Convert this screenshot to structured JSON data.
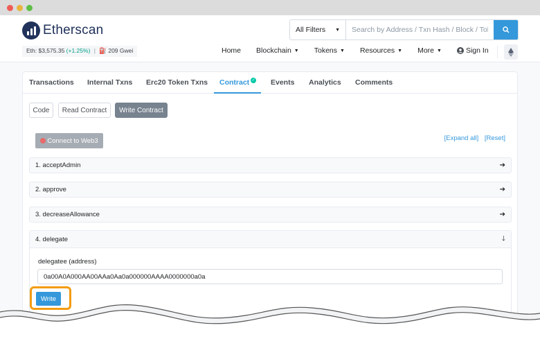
{
  "brand": {
    "name": "Etherscan"
  },
  "stats": {
    "eth_price": "Eth: $3,575.35",
    "change": "(+1.25%)",
    "separator": "|",
    "gas": "209 Gwei"
  },
  "search": {
    "filter": "All Filters",
    "placeholder": "Search by Address / Txn Hash / Block / Token"
  },
  "nav": {
    "home": "Home",
    "blockchain": "Blockchain",
    "tokens": "Tokens",
    "resources": "Resources",
    "more": "More",
    "sign_in": "Sign In"
  },
  "tabs": {
    "transactions": "Transactions",
    "internal": "Internal Txns",
    "erc20": "Erc20 Token Txns",
    "contract": "Contract",
    "events": "Events",
    "analytics": "Analytics",
    "comments": "Comments"
  },
  "subtabs": {
    "code": "Code",
    "read": "Read Contract",
    "write": "Write Contract"
  },
  "connect_label": "Connect to Web3",
  "links": {
    "expand": "[Expand all]",
    "reset": "[Reset]"
  },
  "functions": [
    {
      "label": "1. acceptAdmin"
    },
    {
      "label": "2. approve"
    },
    {
      "label": "3. decreaseAllowance"
    },
    {
      "label": "4. delegate"
    }
  ],
  "delegate": {
    "field_label": "delegatee (address)",
    "field_value": "0a00A0A000AA00AAa0Aa0a000000AAAA0000000a0a",
    "write_label": "Write"
  },
  "colors": {
    "accent": "#3498db",
    "highlight": "#f39c12",
    "success": "#00c9a7"
  }
}
